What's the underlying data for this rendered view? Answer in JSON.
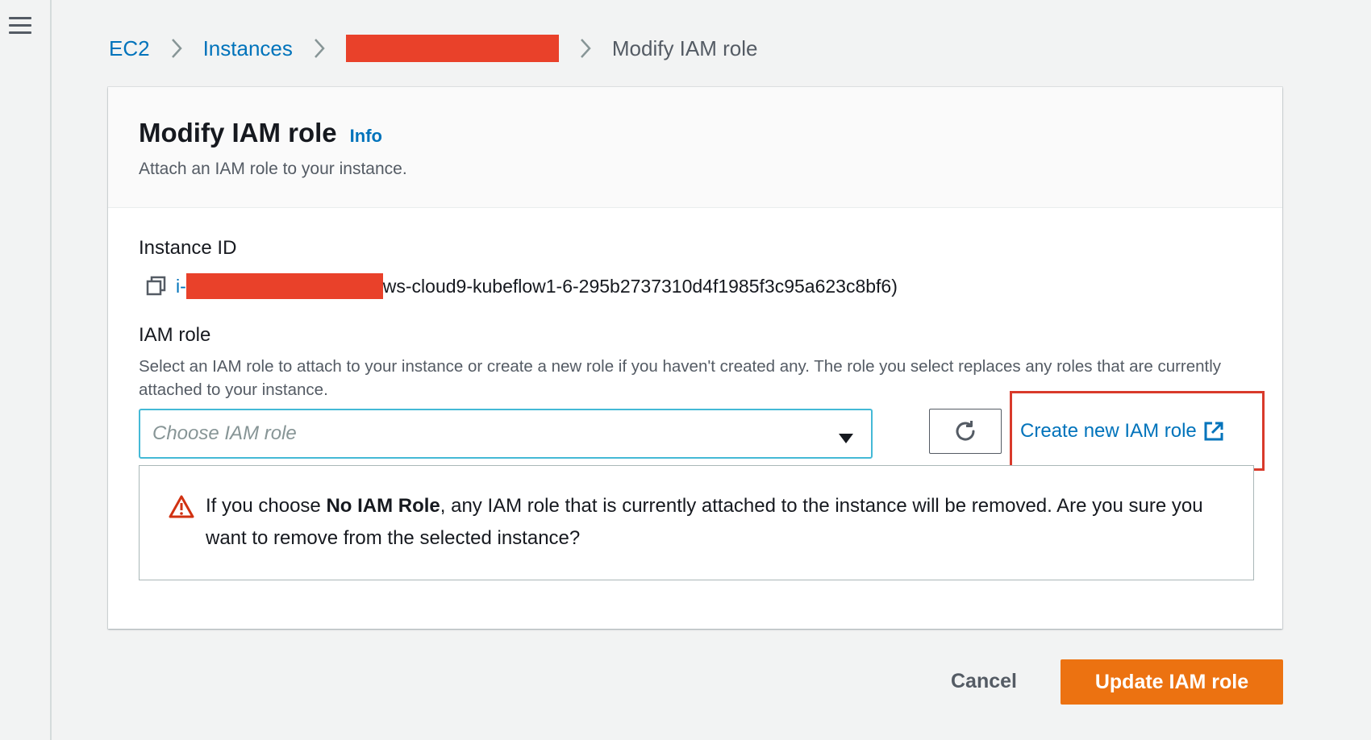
{
  "nav": {
    "menu_icon": "hamburger-menu-icon"
  },
  "breadcrumb": {
    "items": [
      "EC2",
      "Instances"
    ],
    "current": "Modify IAM role"
  },
  "panel": {
    "title": "Modify IAM role",
    "info_label": "Info",
    "description": "Attach an IAM role to your instance."
  },
  "instance": {
    "label": "Instance ID",
    "id_prefix": "i-",
    "id_suffix": "ws-cloud9-kubeflow1-6-295b2737310d4f1985f3c95a623c8bf6)"
  },
  "iam_role": {
    "label": "IAM role",
    "description": "Select an IAM role to attach to your instance or create a new role if you haven't created any. The role you select replaces any roles that are currently attached to your instance.",
    "select_placeholder": "Choose IAM role",
    "create_link": "Create new IAM role"
  },
  "alert": {
    "prefix": "If you choose ",
    "emphasis": "No IAM Role",
    "suffix": ", any IAM role that is currently attached to the instance will be removed. Are you sure you want to remove from the selected instance?"
  },
  "actions": {
    "cancel": "Cancel",
    "update": "Update IAM role"
  },
  "colors": {
    "link": "#0073bb",
    "primary_button": "#ec7211",
    "redaction": "#e9412a",
    "highlight_border": "#d93a2b",
    "warning": "#d13212"
  }
}
